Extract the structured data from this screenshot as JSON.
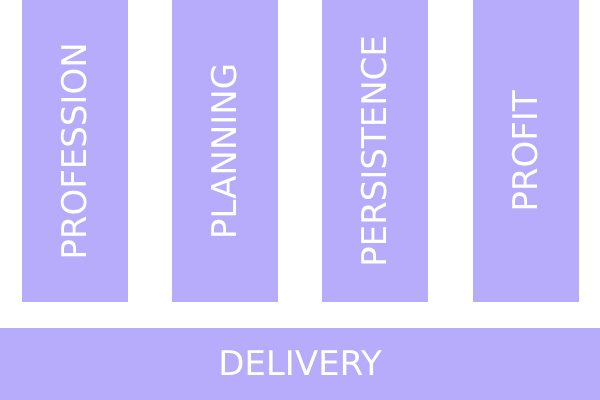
{
  "pillars": [
    {
      "label": "PROFESSION"
    },
    {
      "label": "PLANNING"
    },
    {
      "label": "PERSISTENCE"
    },
    {
      "label": "PROFIT"
    }
  ],
  "base": {
    "label": "DELIVERY"
  },
  "colors": {
    "block_fill": "#b6acfb",
    "text": "#ffffff"
  }
}
